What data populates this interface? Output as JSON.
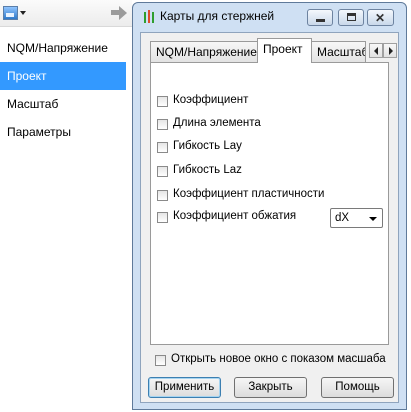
{
  "left_panel": {
    "nav_items": [
      {
        "label": "NQM/Напряжение",
        "selected": false
      },
      {
        "label": "Проект",
        "selected": true
      },
      {
        "label": "Масштаб",
        "selected": false
      },
      {
        "label": "Параметры",
        "selected": false
      }
    ]
  },
  "dialog": {
    "title": "Карты для стержней",
    "tabs": [
      {
        "label": "NQM/Напряжение",
        "active": false
      },
      {
        "label": "Проект",
        "active": true
      },
      {
        "label": "Масштаб",
        "active": false
      }
    ],
    "checkboxes": [
      {
        "label": "Коэффициент",
        "checked": false
      },
      {
        "label": "Длина элемента",
        "checked": false
      },
      {
        "label": "Гибкость Lay",
        "checked": false
      },
      {
        "label": "Гибкость Laz",
        "checked": false
      },
      {
        "label": "Коэффициент пластичности",
        "checked": false
      },
      {
        "label": "Коэффициент обжатия",
        "checked": false
      }
    ],
    "combo_value": "dX",
    "open_new_window_label": "Открыть новое окно с показом масшаба",
    "buttons": {
      "apply": "Применить",
      "close": "Закрыть",
      "help": "Помощь"
    }
  },
  "colors": {
    "selection": "#3399ff",
    "dialog_frame": "#cfe0f3"
  }
}
